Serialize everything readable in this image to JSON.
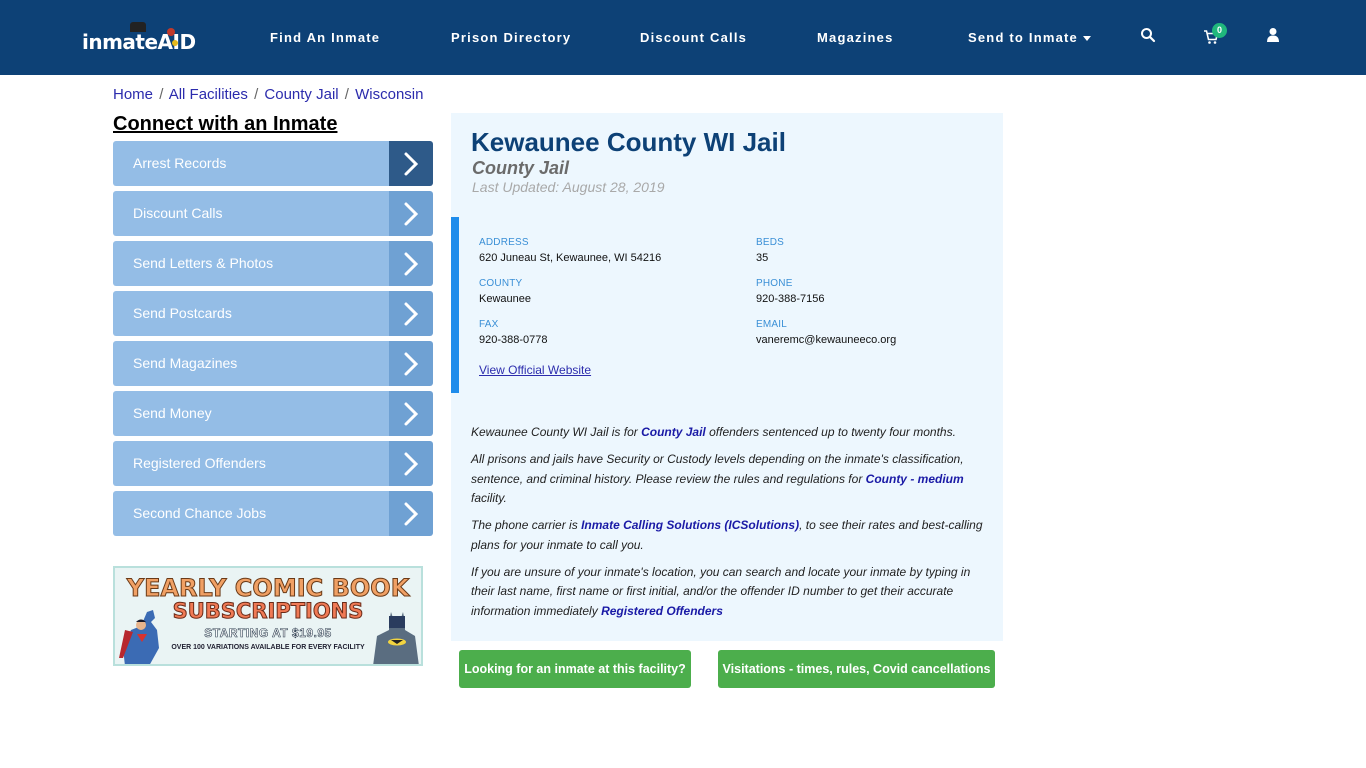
{
  "nav": {
    "logo_text": "inmateAID",
    "items": [
      {
        "label": "Find An Inmate"
      },
      {
        "label": "Prison Directory"
      },
      {
        "label": "Discount Calls"
      },
      {
        "label": "Magazines"
      },
      {
        "label": "Send to Inmate"
      }
    ],
    "cart_count": "0",
    "icons": [
      "search-icon",
      "cart-icon",
      "user-icon"
    ]
  },
  "breadcrumb": [
    {
      "label": "Home"
    },
    {
      "label": "All Facilities"
    },
    {
      "label": "County Jail"
    },
    {
      "label": "Wisconsin"
    }
  ],
  "breadcrumb_sep": "/",
  "sidebar": {
    "title": "Connect with an Inmate",
    "items": [
      {
        "label": "Arrest Records"
      },
      {
        "label": "Discount Calls"
      },
      {
        "label": "Send Letters & Photos"
      },
      {
        "label": "Send Postcards"
      },
      {
        "label": "Send Magazines"
      },
      {
        "label": "Send Money"
      },
      {
        "label": "Registered Offenders"
      },
      {
        "label": "Second Chance Jobs"
      }
    ],
    "banner": {
      "line1": "YEARLY COMIC BOOK",
      "line2": "SUBSCRIPTIONS",
      "line3": "STARTING AT $19.95",
      "line4": "OVER 100 VARIATIONS AVAILABLE FOR EVERY FACILITY"
    }
  },
  "facility": {
    "name": "Kewaunee County WI Jail",
    "type": "County Jail",
    "last_updated": "Last Updated: August 28, 2019",
    "address_label": "ADDRESS",
    "address": "620 Juneau St, Kewaunee, WI 54216",
    "beds_label": "BEDS",
    "beds": "35",
    "county_label": "COUNTY",
    "county": "Kewaunee",
    "phone_label": "PHONE",
    "phone": "920-388-7156",
    "fax_label": "FAX",
    "fax": "920-388-0778",
    "email_label": "EMAIL",
    "email": "vaneremc@kewauneeco.org",
    "website_link": "View Official Website"
  },
  "description": {
    "p1_a": "Kewaunee County WI Jail is for ",
    "p1_link": "County Jail",
    "p1_b": " offenders sentenced up to twenty four months.",
    "p2_a": "All prisons and jails have Security or Custody levels depending on the inmate's classification, sentence, and criminal history. Please review the rules and regulations for ",
    "p2_link": "County - medium",
    "p2_b": " facility.",
    "p3_a": "The phone carrier is ",
    "p3_link": "Inmate Calling Solutions (ICSolutions)",
    "p3_b": ", to see their rates and best-calling plans for your inmate to call you.",
    "p4_a": "If you are unsure of your inmate's location, you can search and locate your inmate by typing in their last name, first name or first initial, and/or the offender ID number to get their accurate information immediately ",
    "p4_link": "Registered Offenders"
  },
  "buttons": {
    "find_inmate": "Looking for an inmate at this facility?",
    "visitations": "Visitations - times, rules, Covid cancellations"
  },
  "colors": {
    "navbar": "#0d4176",
    "sidebar_item": "#94bde6",
    "sidebar_arrow": "#6fa1d3",
    "sidebar_arrow_active": "#2e5a89",
    "panel_bg": "#edf7fe",
    "info_accent": "#1f8ceb",
    "button_green": "#4cae4c",
    "cart_badge": "#20b77c"
  }
}
